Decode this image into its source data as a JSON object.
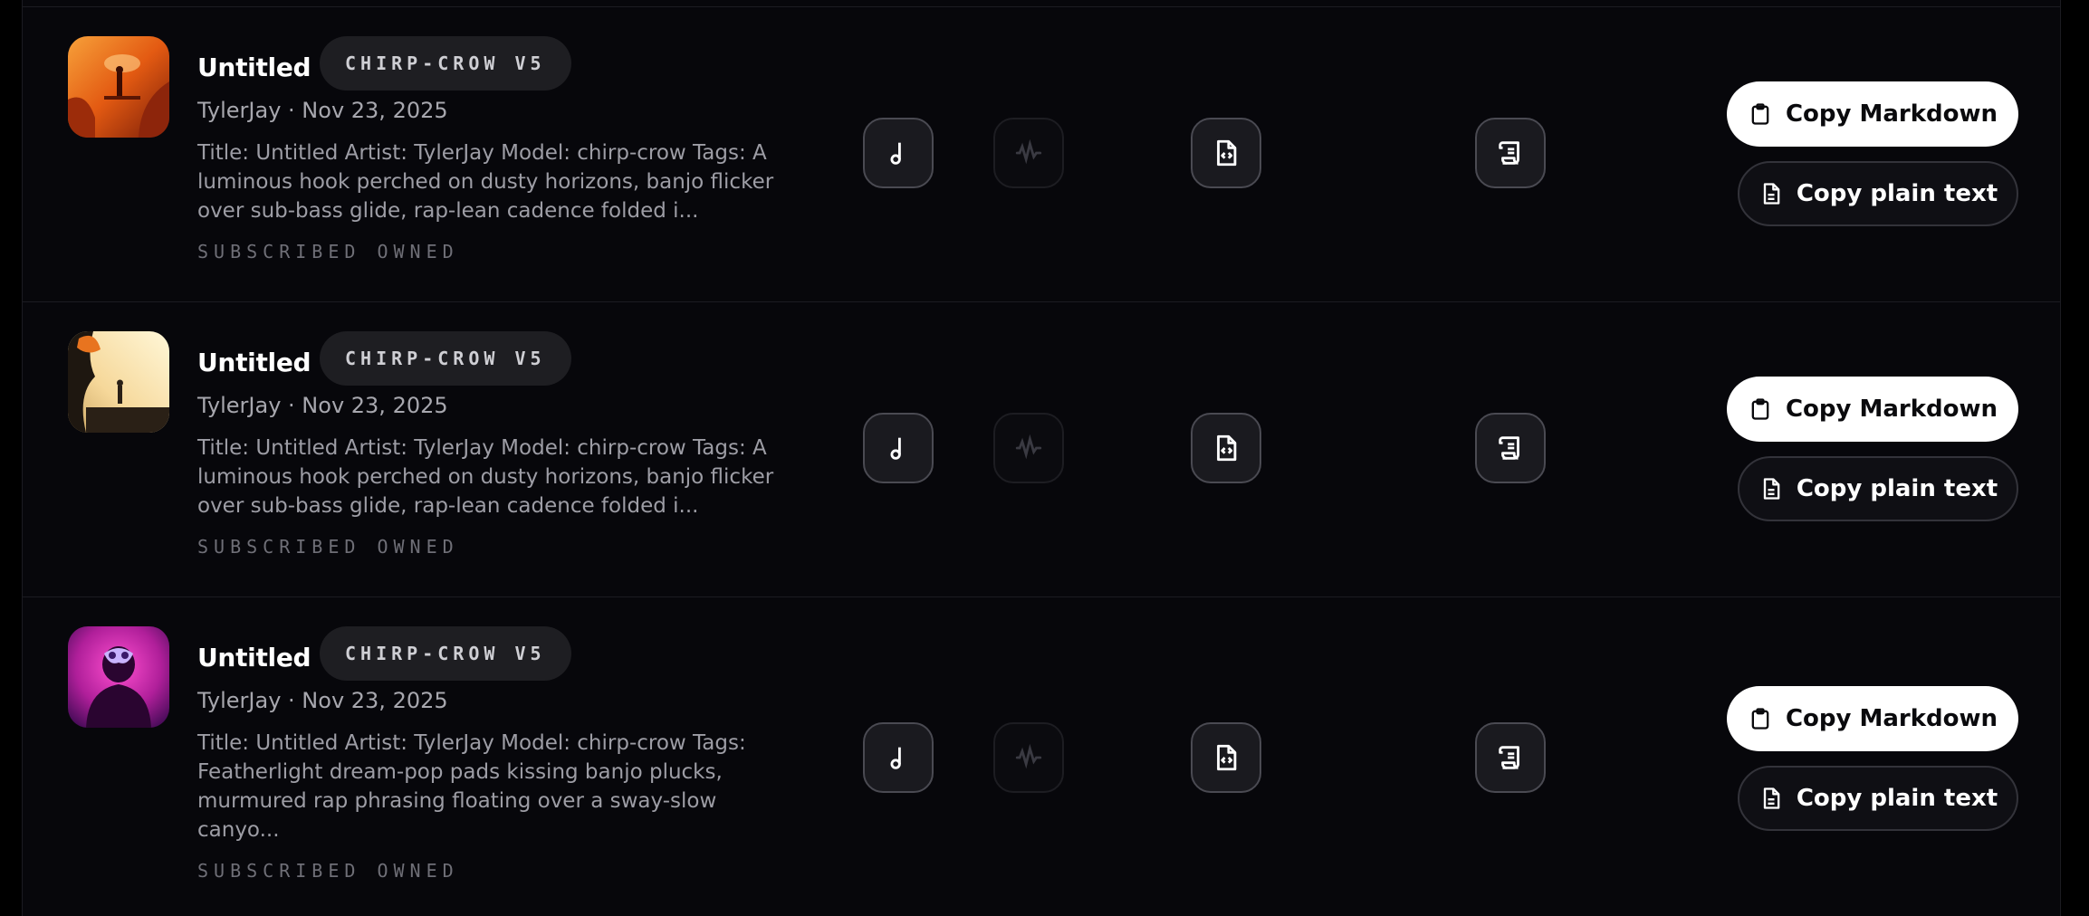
{
  "songs": [
    {
      "title": "Untitled",
      "model": "CHIRP-CROW V5",
      "meta": "TylerJay · Nov 23, 2025",
      "description": "Title: Untitled Artist: TylerJay Model: chirp-crow Tags: A luminous hook perched on dusty horizons, banjo flicker over sub-bass glide, rap-lean cadence folded i...",
      "tags": "SUBSCRIBED OWNED",
      "cover": "orange-canyon-figure",
      "copy_markdown": "Copy Markdown",
      "copy_plain": "Copy plain text"
    },
    {
      "title": "Untitled",
      "model": "CHIRP-CROW V5",
      "meta": "TylerJay · Nov 23, 2025",
      "description": "Title: Untitled Artist: TylerJay Model: chirp-crow Tags: A luminous hook perched on dusty horizons, banjo flicker over sub-bass glide, rap-lean cadence folded i...",
      "tags": "SUBSCRIBED OWNED",
      "cover": "cream-cliff-figure",
      "copy_markdown": "Copy Markdown",
      "copy_plain": "Copy plain text"
    },
    {
      "title": "Untitled",
      "model": "CHIRP-CROW V5",
      "meta": "TylerJay · Nov 23, 2025",
      "description": "Title: Untitled Artist: TylerJay Model: chirp-crow Tags: Featherlight dream-pop pads kissing banjo plucks, murmured rap phrasing floating over a sway-slow canyo...",
      "tags": "SUBSCRIBED OWNED",
      "cover": "magenta-masked-figure",
      "copy_markdown": "Copy Markdown",
      "copy_plain": "Copy plain text"
    }
  ],
  "icons": {
    "audio": "music-note-icon",
    "waveform": "waveform-icon",
    "json": "code-file-icon",
    "lyrics": "scroll-icon",
    "markdown": "clipboard-icon",
    "plain": "document-icon"
  },
  "colors": {
    "background": "#07070b",
    "primary_button": "#ffffff",
    "badge": "#1e1e22"
  }
}
